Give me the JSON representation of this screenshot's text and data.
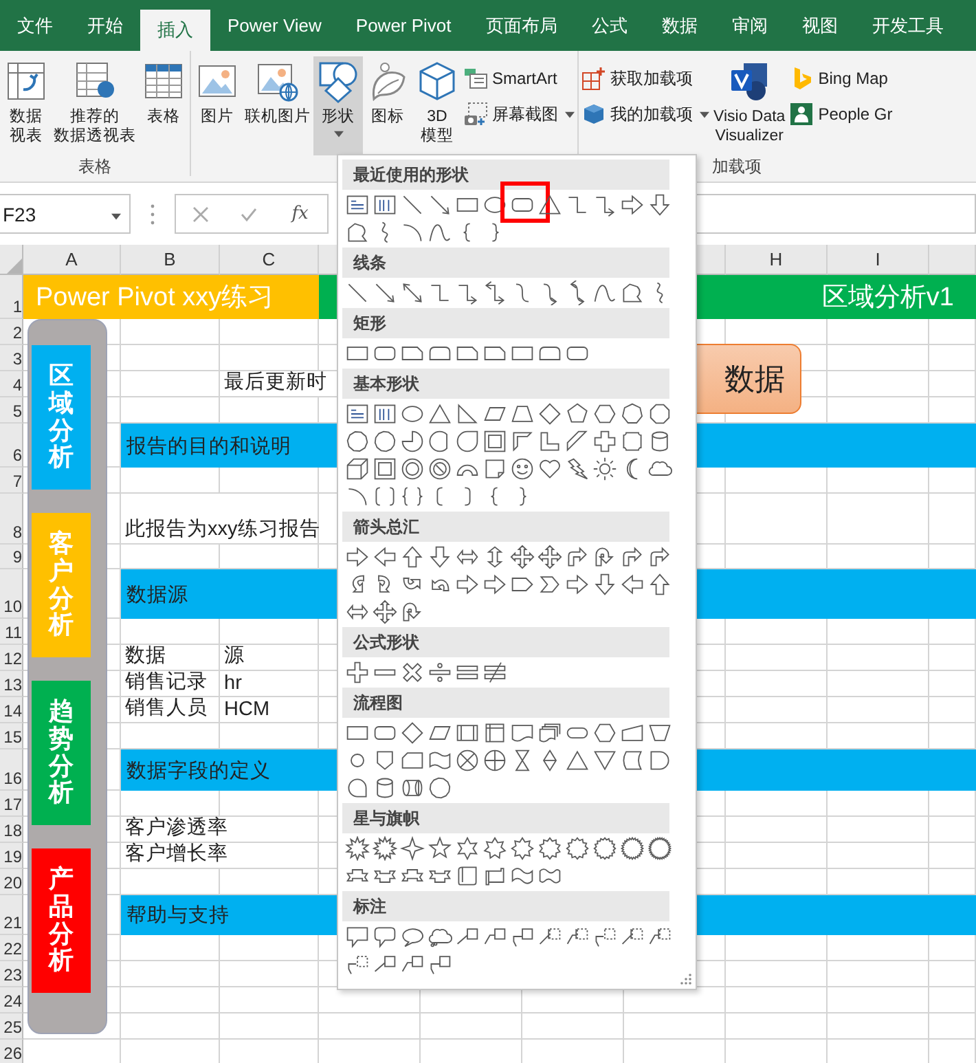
{
  "ribbon": {
    "tabs": [
      {
        "label": "文件",
        "selected": false
      },
      {
        "label": "开始",
        "selected": false
      },
      {
        "label": "插入",
        "selected": true
      },
      {
        "label": "Power View",
        "selected": false
      },
      {
        "label": "Power Pivot",
        "selected": false
      },
      {
        "label": "页面布局",
        "selected": false
      },
      {
        "label": "公式",
        "selected": false
      },
      {
        "label": "数据",
        "selected": false
      },
      {
        "label": "审阅",
        "selected": false
      },
      {
        "label": "视图",
        "selected": false
      },
      {
        "label": "开发工具",
        "selected": false
      }
    ],
    "groups": [
      {
        "label": "表格",
        "items": [
          {
            "kind": "pivot",
            "lines": [
              "数据",
              "视表"
            ],
            "pressed": false
          },
          {
            "kind": "recommended",
            "lines": [
              "推荐的",
              "数据透视表"
            ],
            "pressed": false
          },
          {
            "kind": "table",
            "lines": [
              "表格"
            ],
            "pressed": false
          }
        ]
      },
      {
        "items": [
          {
            "kind": "picture",
            "lines": [
              "图片"
            ],
            "pressed": false
          },
          {
            "kind": "online",
            "lines": [
              "联机图片"
            ],
            "pressed": false
          },
          {
            "kind": "shapes",
            "lines": [
              "形状"
            ],
            "pressed": true,
            "dropdown": true
          },
          {
            "kind": "icons",
            "lines": [
              "图标"
            ],
            "pressed": false
          },
          {
            "kind": "model",
            "lines": [
              "3D",
              "模型"
            ],
            "pressed": false
          },
          {
            "kind": "stack",
            "items": [
              {
                "kind": "smartart",
                "label": "SmartArt"
              },
              {
                "kind": "screenshot",
                "label": "屏幕截图",
                "dropdown": true
              }
            ]
          }
        ]
      },
      {
        "label": "加载项",
        "items": [
          {
            "kind": "stack",
            "items": [
              {
                "kind": "store",
                "label": "获取加载项"
              },
              {
                "kind": "addins",
                "label": "我的加载项",
                "dropdown": true
              }
            ]
          },
          {
            "kind": "visio",
            "lines": [
              "Visio Data",
              "Visualizer"
            ],
            "pressed": false
          },
          {
            "kind": "stack",
            "items": [
              {
                "kind": "bing",
                "label": "Bing Map"
              },
              {
                "kind": "people",
                "label": "People Gr"
              }
            ]
          }
        ]
      }
    ]
  },
  "formula_bar": {
    "name_box": "F23",
    "function_button": "fx"
  },
  "sheet": {
    "column_headers": [
      "A",
      "B",
      "C",
      "H",
      "I"
    ],
    "rows": [
      {
        "number": "1",
        "kind": "title",
        "left": "Power Pivot xxy练习",
        "right": "区域分析v1"
      },
      {
        "number": "2",
        "kind": "cells"
      },
      {
        "number": "3",
        "kind": "cells"
      },
      {
        "number": "4",
        "kind": "cells",
        "column_c": "最后更新时"
      },
      {
        "number": "5",
        "kind": "cells"
      },
      {
        "number": "6",
        "kind": "band",
        "text": "报告的目的和说明"
      },
      {
        "number": "7",
        "kind": "cells"
      },
      {
        "number": "8",
        "kind": "cells",
        "column_b": "此报告为xxy练习报告"
      },
      {
        "number": "9",
        "kind": "cells"
      },
      {
        "number": "10",
        "kind": "band",
        "text": "数据源"
      },
      {
        "number": "11",
        "kind": "cells"
      },
      {
        "number": "12",
        "kind": "cells",
        "column_b": "数据",
        "column_c": "源"
      },
      {
        "number": "13",
        "kind": "cells",
        "column_b": "销售记录",
        "column_c": "hr"
      },
      {
        "number": "14",
        "kind": "cells",
        "column_b": "销售人员",
        "column_c": "HCM"
      },
      {
        "number": "15",
        "kind": "cells"
      },
      {
        "number": "16",
        "kind": "band",
        "text": "数据字段的定义"
      },
      {
        "number": "17",
        "kind": "cells"
      },
      {
        "number": "18",
        "kind": "cells",
        "column_b": "客户渗透率"
      },
      {
        "number": "19",
        "kind": "cells",
        "column_b": "客户增长率"
      },
      {
        "number": "20",
        "kind": "cells"
      },
      {
        "number": "21",
        "kind": "band",
        "text": "帮助与支持"
      },
      {
        "number": "22",
        "kind": "cells"
      },
      {
        "number": "23",
        "kind": "cells"
      },
      {
        "number": "24",
        "kind": "cells"
      },
      {
        "number": "25",
        "kind": "cells"
      },
      {
        "number": "26",
        "kind": "cells"
      }
    ],
    "nav_buttons": [
      {
        "label": "区域分析",
        "color": "#00b0f0"
      },
      {
        "label": "客户分析",
        "color": "#ffc000"
      },
      {
        "label": "趋势分析",
        "color": "#00b050"
      },
      {
        "label": "产品分析",
        "color": "#ff0000"
      }
    ],
    "update_button": "数据"
  },
  "shape_menu": {
    "sections": [
      {
        "title": "最近使用的形状",
        "highlight_frame": true
      },
      {
        "title": "线条"
      },
      {
        "title": "矩形"
      },
      {
        "title": "基本形状"
      },
      {
        "title": "箭头总汇"
      },
      {
        "title": "公式形状"
      },
      {
        "title": "流程图"
      },
      {
        "title": "星与旗帜"
      },
      {
        "title": "标注"
      }
    ]
  }
}
